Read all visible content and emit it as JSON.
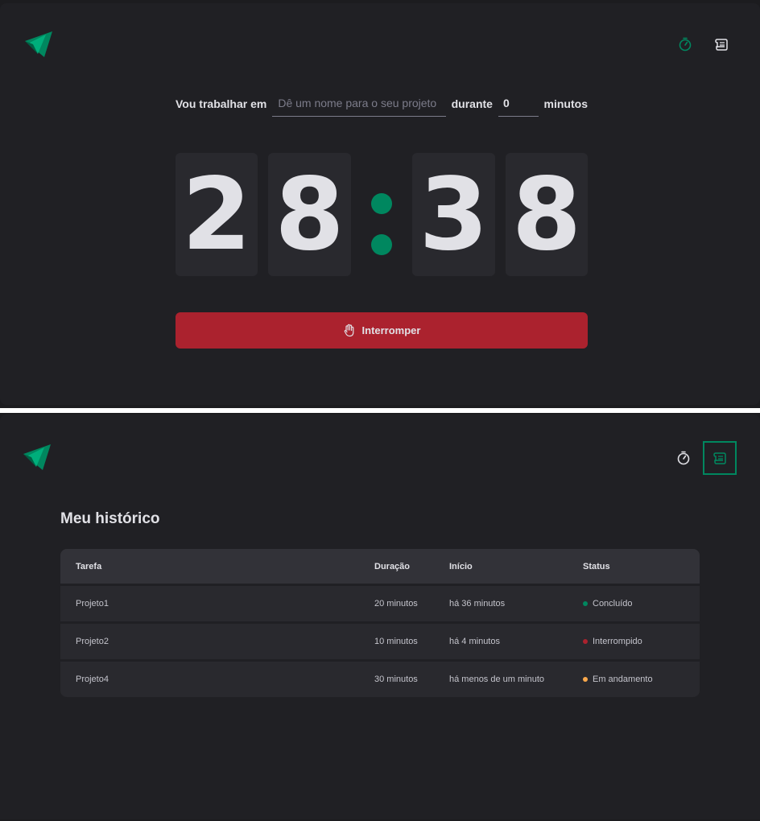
{
  "timer_view": {
    "form": {
      "label_before": "Vou trabalhar em",
      "task_placeholder": "Dê um nome para o seu projeto",
      "label_middle": "durante",
      "minutes_value": "0",
      "label_after": "minutos"
    },
    "countdown": {
      "minutes_tens": "2",
      "minutes_ones": "8",
      "seconds_tens": "3",
      "seconds_ones": "8"
    },
    "stop_button_label": "Interromper",
    "active_nav": "timer"
  },
  "history_view": {
    "title": "Meu histórico",
    "active_nav": "history",
    "columns": [
      "Tarefa",
      "Duração",
      "Início",
      "Status"
    ],
    "rows": [
      {
        "task": "Projeto1",
        "duration": "20 minutos",
        "start": "há 36 minutos",
        "status": "Concluído",
        "status_color": "#00875f"
      },
      {
        "task": "Projeto2",
        "duration": "10 minutos",
        "start": "há 4 minutos",
        "status": "Interrompido",
        "status_color": "#ab222e"
      },
      {
        "task": "Projeto4",
        "duration": "30 minutos",
        "start": "há menos de um minuto",
        "status": "Em andamento",
        "status_color": "#fba94c"
      }
    ]
  },
  "colors": {
    "accent": "#00875f",
    "danger": "#ab222e",
    "warning": "#fba94c",
    "background": "#202024"
  },
  "icons": {
    "logo": "ignite-logo-icon",
    "timer": "timer-icon",
    "history": "scroll-icon",
    "stop": "hand-palm-icon"
  }
}
